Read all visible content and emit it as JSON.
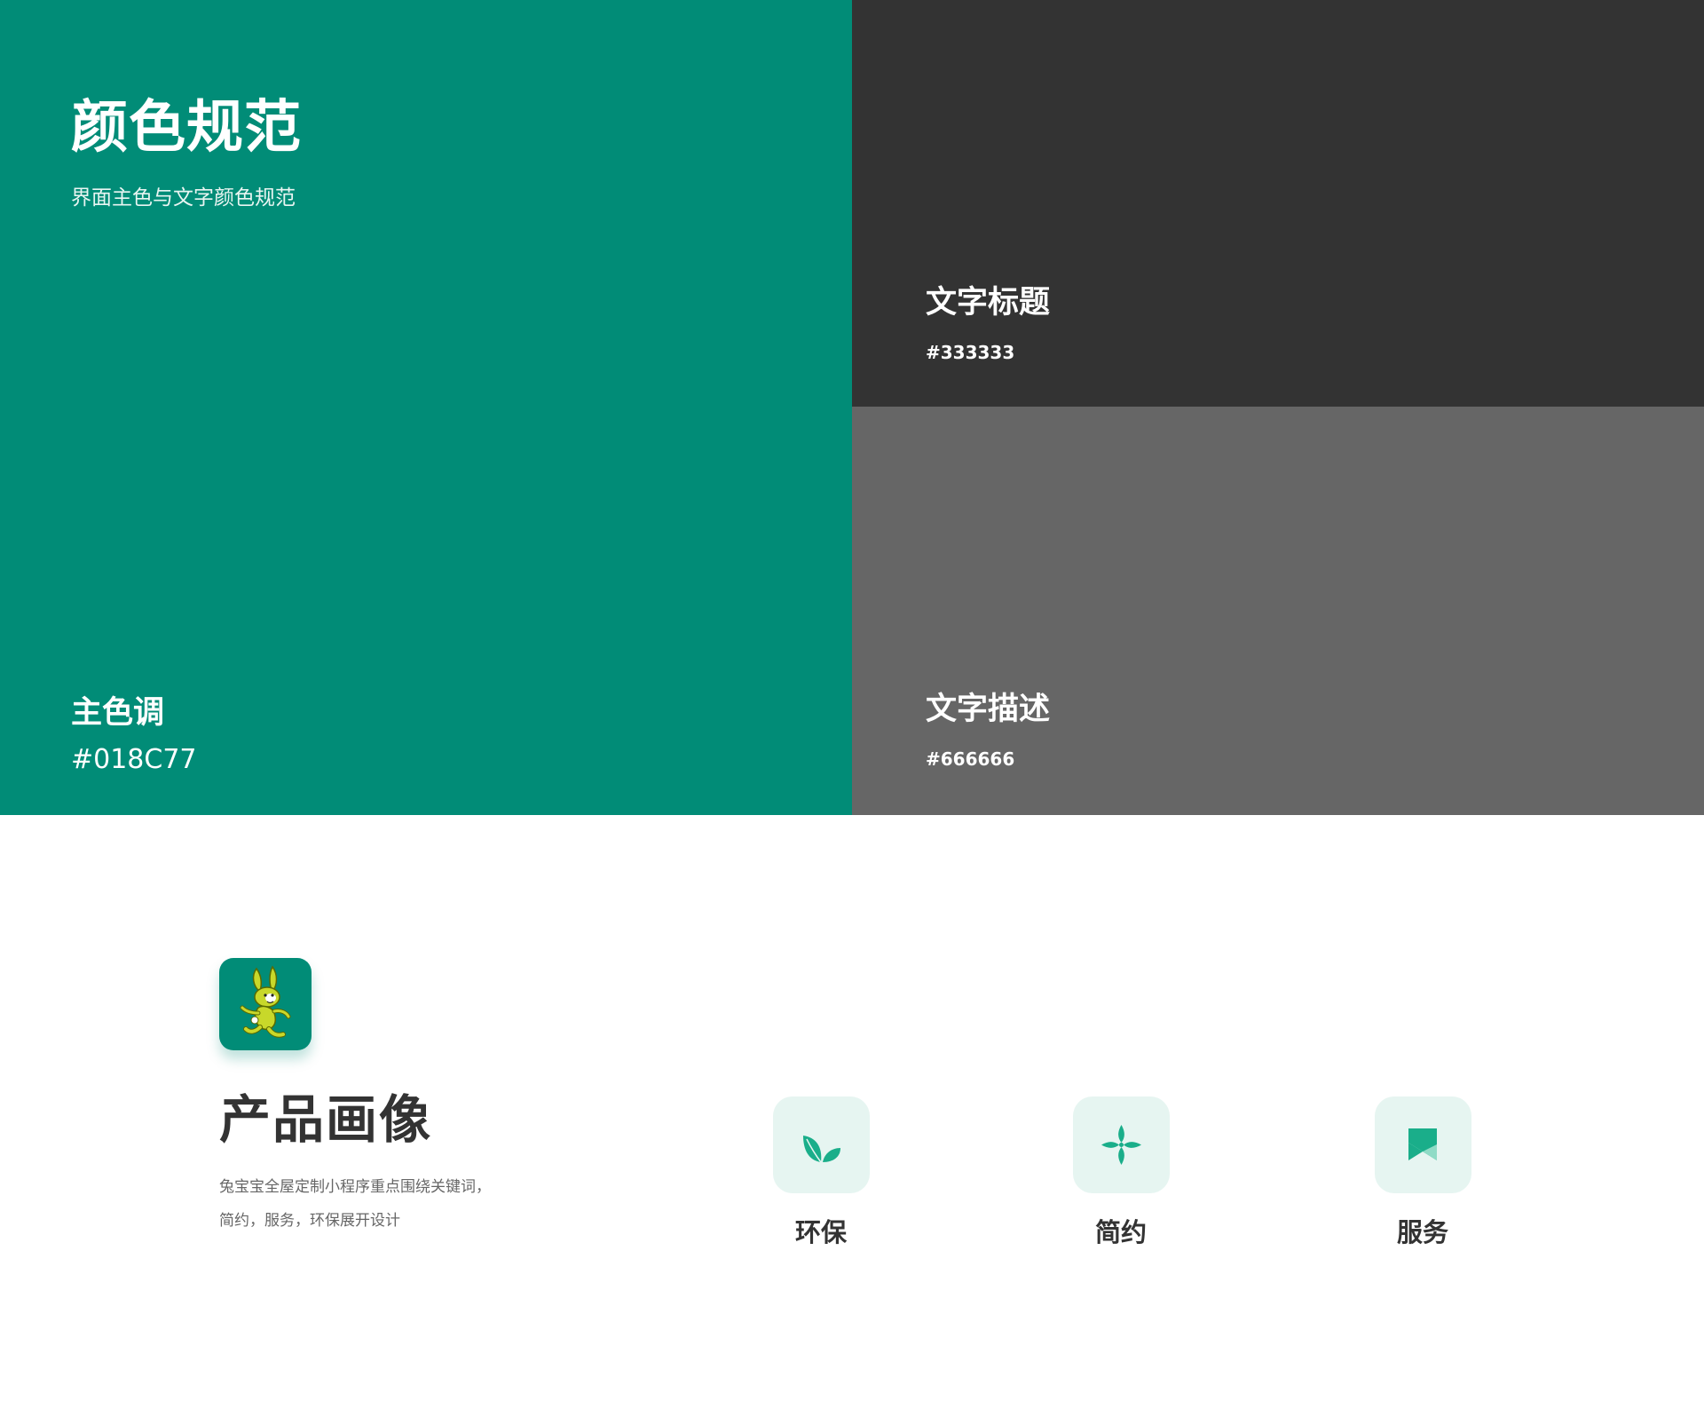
{
  "header": {
    "title": "颜色规范",
    "subtitle": "界面主色与文字颜色规范"
  },
  "swatches": {
    "primary": {
      "name": "主色调",
      "hex": "#018C77",
      "color": "#018C77"
    },
    "heading_text": {
      "name": "文字标题",
      "hex": "#333333",
      "color": "#333333"
    },
    "description_text": {
      "name": "文字描述",
      "hex": "#666666",
      "color": "#666666"
    }
  },
  "product": {
    "logo_icon": "rabbit-mascot-icon",
    "title": "产品画像",
    "description_lines": [
      "兔宝宝全屋定制小程序重点围绕关键词，",
      "简约，服务，环保展开设计"
    ]
  },
  "features": [
    {
      "label": "环保",
      "icon": "leaf-icon",
      "icon_color": "#1AAE8A",
      "bg_color": "#E6F5F1"
    },
    {
      "label": "简约",
      "icon": "four-petal-icon",
      "icon_color": "#1AAE8A",
      "bg_color": "#E6F5F1"
    },
    {
      "label": "服务",
      "icon": "bookmark-flag-icon",
      "icon_color": "#1AAE8A",
      "bg_color": "#E6F5F1"
    }
  ]
}
